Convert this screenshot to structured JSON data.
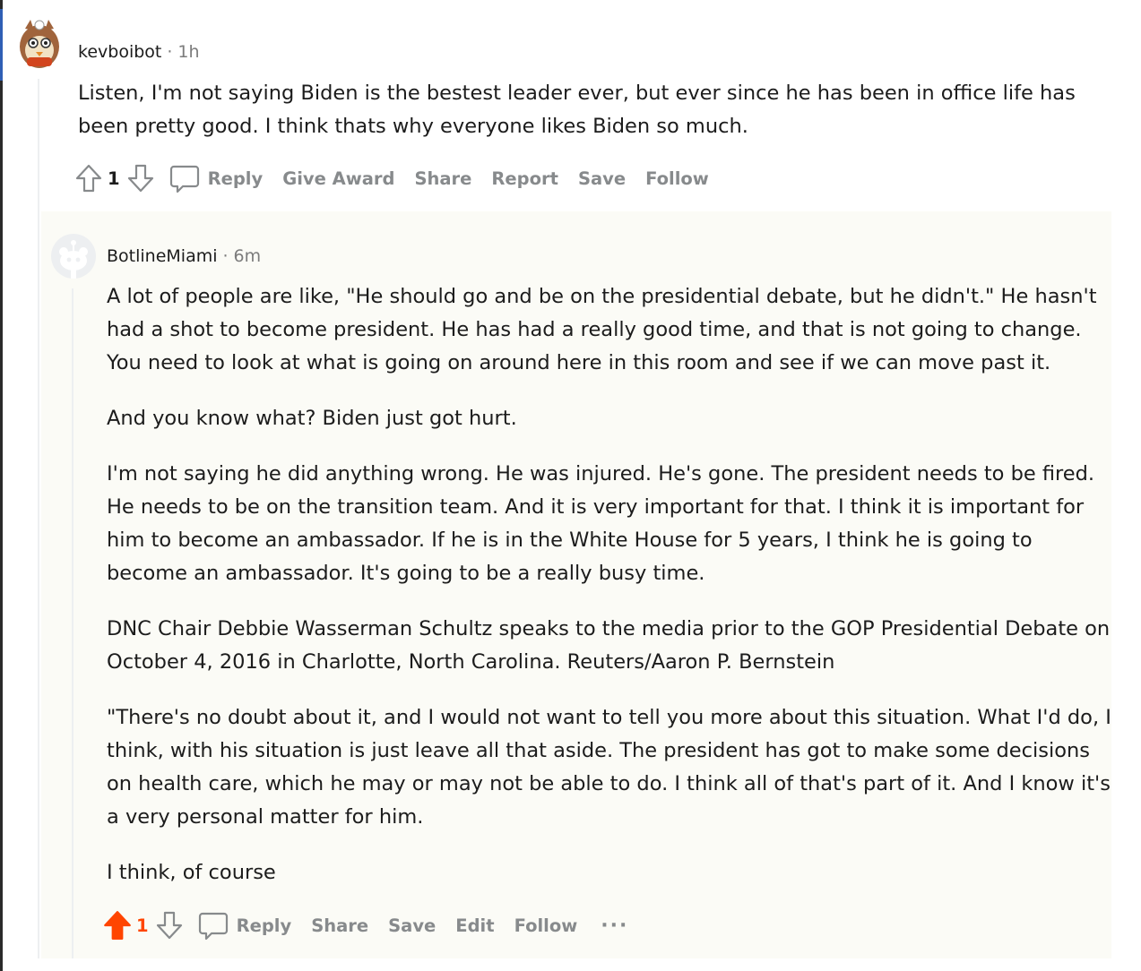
{
  "comment": {
    "author": "kevboibot",
    "time": "1h",
    "separator": "·",
    "body": "Listen, I'm not saying Biden is the bestest leader ever, but ever since he has been in office life has been pretty good. I think thats why everyone likes Biden so much.",
    "score": "1",
    "actions": {
      "reply": "Reply",
      "give_award": "Give Award",
      "share": "Share",
      "report": "Report",
      "save": "Save",
      "follow": "Follow"
    }
  },
  "reply": {
    "author": "BotlineMiami",
    "time": "6m",
    "separator": "·",
    "paragraphs": [
      "A lot of people are like, \"He should go and be on the presidential debate, but he didn't.\" He hasn't had a shot to become president. He has had a really good time, and that is not going to change. You need to look at what is going on around here in this room and see if we can move past it.",
      "And you know what? Biden just got hurt.",
      "I'm not saying he did anything wrong. He was injured. He's gone. The president needs to be fired. He needs to be on the transition team. And it is very important for that. I think it is important for him to become an ambassador. If he is in the White House for 5 years, I think he is going to become an ambassador. It's going to be a really busy time.",
      "DNC Chair Debbie Wasserman Schultz speaks to the media prior to the GOP Presidential Debate on October 4, 2016 in Charlotte, North Carolina. Reuters/Aaron P. Bernstein",
      "\"There's no doubt about it, and I would not want to tell you more about this situation. What I'd do, I think, with his situation is just leave all that aside. The president has got to make some decisions on health care, which he may or may not be able to do. I think all of that's part of it. And I know it's a very personal matter for him.",
      "I think, of course"
    ],
    "score": "1",
    "upvoted": true,
    "actions": {
      "reply": "Reply",
      "share": "Share",
      "save": "Save",
      "edit": "Edit",
      "follow": "Follow",
      "more": "···"
    }
  },
  "colors": {
    "upvote_active": "#ff4500",
    "action_text": "#878a8c",
    "reply_background": "#fbfbf6",
    "thread_line": "#edeff1"
  },
  "icons": [
    "upvote-icon",
    "downvote-icon",
    "comment-icon",
    "more-icon"
  ]
}
